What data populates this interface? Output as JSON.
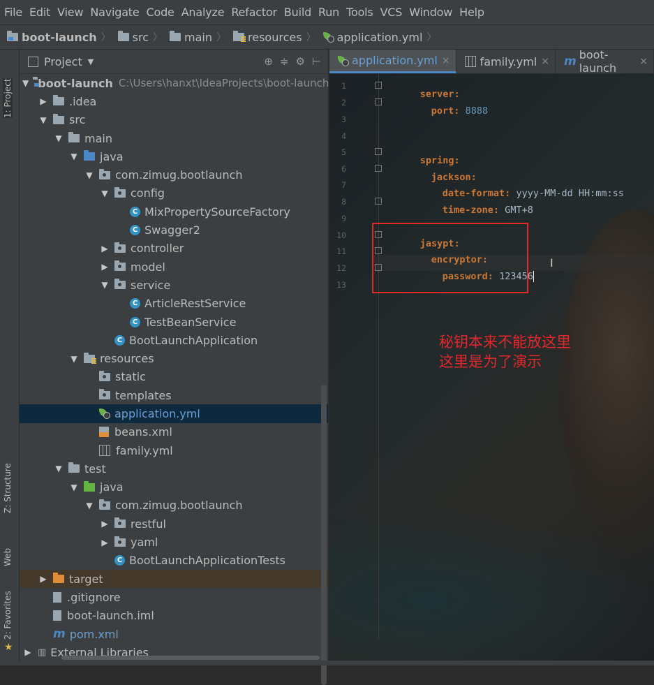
{
  "menu": [
    "File",
    "Edit",
    "View",
    "Navigate",
    "Code",
    "Analyze",
    "Refactor",
    "Build",
    "Run",
    "Tools",
    "VCS",
    "Window",
    "Help"
  ],
  "breadcrumb": [
    "boot-launch",
    "src",
    "main",
    "resources",
    "application.yml"
  ],
  "side_tabs": {
    "project": "1: Project",
    "structure": "Z: Structure",
    "web": "Web",
    "favorites": "2: Favorites"
  },
  "panel": {
    "title": "Project"
  },
  "tree": {
    "root_label": "boot-launch",
    "root_path": "C:\\Users\\hanxt\\IdeaProjects\\boot-launch",
    "idea": ".idea",
    "src": "src",
    "main": "main",
    "java": "java",
    "pkg": "com.zimug.bootlaunch",
    "config": "config",
    "mix": "MixPropertySourceFactory",
    "swagger": "Swagger2",
    "controller": "controller",
    "model": "model",
    "service": "service",
    "article": "ArticleRestService",
    "testbean": "TestBeanService",
    "bootapp": "BootLaunchApplication",
    "resources": "resources",
    "static": "static",
    "templates": "templates",
    "appyml": "application.yml",
    "beans": "beans.xml",
    "family": "family.yml",
    "test": "test",
    "testjava": "java",
    "testpkg": "com.zimug.bootlaunch",
    "restful": "restful",
    "yaml": "yaml",
    "apptests": "BootLaunchApplicationTests",
    "target": "target",
    "gitignore": ".gitignore",
    "iml": "boot-launch.iml",
    "pom": "pom.xml",
    "extlib": "External Libraries"
  },
  "tabs": [
    "application.yml",
    "family.yml",
    "boot-launch"
  ],
  "code": {
    "l1": "server:",
    "l2k": "port:",
    "l2v": "8888",
    "l5": "spring:",
    "l6": "jackson:",
    "l7k": "date-format:",
    "l7v": "yyyy-MM-dd HH:mm:ss",
    "l8k": "time-zone:",
    "l8v": "GMT+8",
    "l10": "jasypt:",
    "l11": "encryptor:",
    "l12k": "password:",
    "l12v": "123456"
  },
  "line_numbers": [
    "1",
    "2",
    "3",
    "4",
    "5",
    "6",
    "7",
    "8",
    "9",
    "10",
    "11",
    "12",
    "13"
  ],
  "annotation": {
    "line1": "秘钥本来不能放这里",
    "line2": "这里是为了演示"
  }
}
